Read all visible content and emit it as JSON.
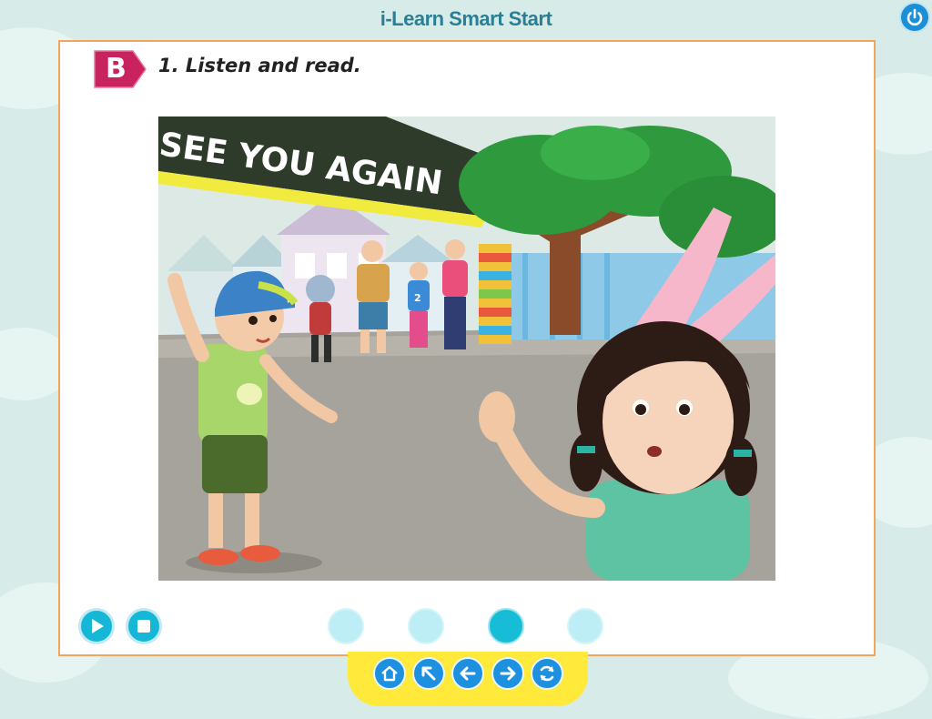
{
  "app": {
    "title": "i-Learn Smart Start"
  },
  "section": {
    "badge": "B",
    "heading": "1. Listen and read."
  },
  "scene": {
    "banner_text": "SEE YOU AGAIN",
    "shirt_number": "2"
  },
  "player": {
    "controls": [
      "play-icon",
      "stop-icon"
    ]
  },
  "pagination": {
    "count": 4,
    "current": 3
  },
  "nav": {
    "buttons": [
      "home-icon",
      "arrow-up-left-icon",
      "arrow-left-icon",
      "arrow-right-icon",
      "refresh-icon"
    ]
  },
  "colors": {
    "accent": "#16b6d6",
    "badge": "#c8235f",
    "frame": "#f2a55c",
    "navbar": "#ffe93a"
  }
}
